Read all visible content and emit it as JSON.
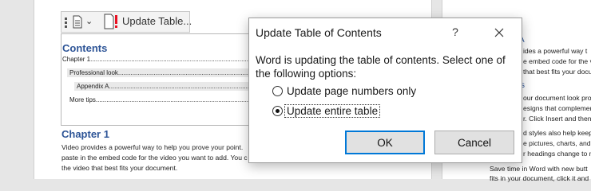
{
  "toolbar": {
    "update_label": "Update Table..."
  },
  "toc": {
    "heading": "Contents",
    "entries": [
      {
        "text": "Chapter 1",
        "dots": "..............................................................................................................................................."
      },
      {
        "text": "Professional look",
        "dots": "......................................................................................................................................."
      },
      {
        "text": "Appendix A",
        "dots": "........................................................................................................................................"
      },
      {
        "text": "More tips",
        "dots": "..................................................................................................................................."
      }
    ]
  },
  "document": {
    "chapter_heading": "Chapter 1",
    "paragraph": [
      "Video provides a powerful way to help you prove your point.",
      "paste in the embed code for the video you want to add. You c",
      "the video that best fits your document."
    ]
  },
  "right_page": {
    "heading_a": "A",
    "lines_a": [
      "ides a powerful way t",
      "e embed code for the v",
      "that best fits your docu"
    ],
    "heading_b": "s",
    "lines_b": [
      "our document look pro",
      "esigns that complemen",
      "r. Click Insert and then"
    ],
    "lines_c": [
      "d styles also help keep",
      "e pictures, charts, and S",
      "r headings change to m"
    ],
    "lines_d": [
      "Save time in Word with new butt",
      "fits in your document, click it and"
    ]
  },
  "dialog": {
    "title": "Update Table of Contents",
    "help": "?",
    "message": "Word is updating the table of contents.  Select one of the following options:",
    "option_page_numbers": "Update page numbers only",
    "option_entire_table": "Update entire table",
    "selected_option": "entire_table",
    "ok_label": "OK",
    "cancel_label": "Cancel"
  },
  "colors": {
    "accent_heading": "#2e5597",
    "focus_border": "#0078d7"
  }
}
